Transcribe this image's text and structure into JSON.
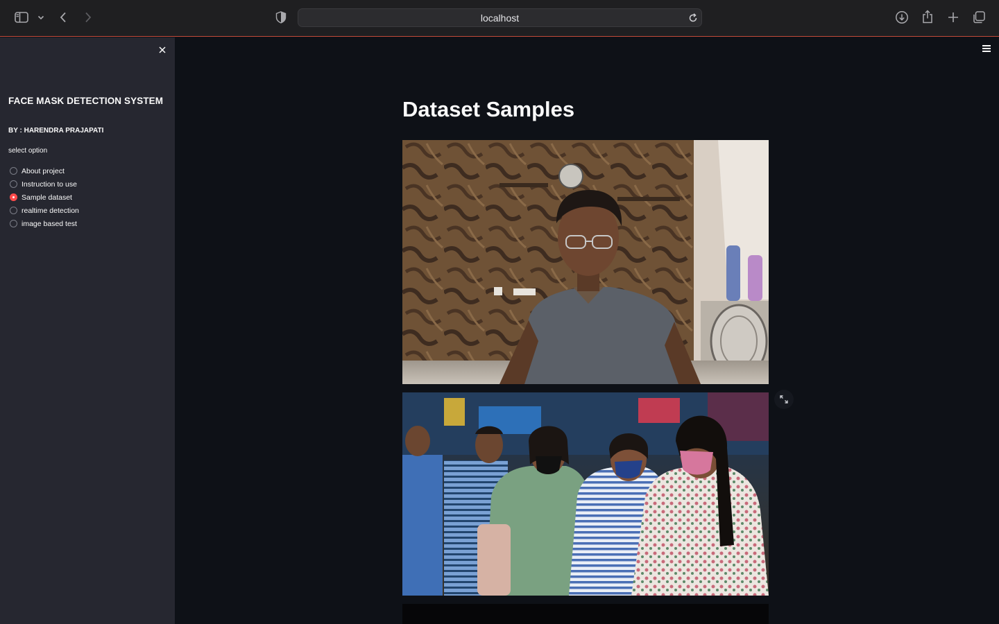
{
  "browser": {
    "url": "localhost",
    "icons": [
      "sidebar-icon",
      "chevron-down-icon",
      "back-arrow-icon",
      "forward-arrow-icon",
      "shield-icon",
      "reload-icon",
      "download-icon",
      "share-icon",
      "plus-icon",
      "tabs-icon"
    ]
  },
  "sidebar": {
    "title": "FACE MASK DETECTION SYSTEM",
    "author": "BY : HARENDRA PRAJAPATI",
    "select_label": "select option",
    "options": [
      {
        "label": "About project",
        "selected": false
      },
      {
        "label": "Instruction to use",
        "selected": false
      },
      {
        "label": "Sample dataset",
        "selected": true
      },
      {
        "label": "realtime detection",
        "selected": false
      },
      {
        "label": "image based test",
        "selected": false
      }
    ]
  },
  "main": {
    "title": "Dataset Samples"
  },
  "colors": {
    "accent": "#ff4b4b",
    "background": "#0e1117",
    "sidebar": "#262730",
    "text": "#fafafa"
  }
}
